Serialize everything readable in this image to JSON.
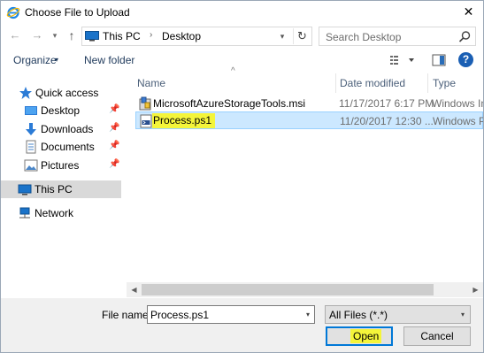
{
  "window": {
    "title": "Choose File to Upload",
    "close_glyph": "✕",
    "icon": "internet-explorer-icon"
  },
  "nav": {
    "back_glyph": "←",
    "forward_glyph": "→",
    "recent_glyph": "▾",
    "up_glyph": "↑",
    "address": {
      "breadcrumbs": [
        "This PC",
        "Desktop"
      ],
      "separator": "›",
      "dropdown_glyph": "▾",
      "refresh_glyph": "↻"
    },
    "search": {
      "placeholder": "Search Desktop"
    }
  },
  "toolbar": {
    "organize_label": "Organize",
    "organize_caret": "▾",
    "new_folder_label": "New folder",
    "help_glyph": "?"
  },
  "sidebar": {
    "pin_glyph": "📌",
    "items": [
      {
        "label": "Quick access",
        "icon": "star-icon",
        "pinned": false
      },
      {
        "label": "Desktop",
        "icon": "desktop-folder-icon",
        "pinned": true
      },
      {
        "label": "Downloads",
        "icon": "download-arrow-icon",
        "pinned": true
      },
      {
        "label": "Documents",
        "icon": "documents-icon",
        "pinned": true
      },
      {
        "label": "Pictures",
        "icon": "pictures-icon",
        "pinned": true
      },
      {
        "label": "This PC",
        "icon": "computer-icon",
        "selected": true
      },
      {
        "label": "Network",
        "icon": "network-icon"
      }
    ]
  },
  "file_list": {
    "sort_caret": "^",
    "columns": [
      "Name",
      "Date modified",
      "Type"
    ],
    "rows": [
      {
        "name": "MicrosoftAzureStorageTools.msi",
        "date": "11/17/2017 6:17 PM",
        "type": "Windows Installer",
        "icon": "msi-installer-icon",
        "selected": false
      },
      {
        "name": "Process.ps1",
        "date": "11/20/2017 12:30 ...",
        "type": "Windows PowerShell",
        "icon": "powershell-script-icon",
        "selected": true
      }
    ]
  },
  "scrollbar": {
    "left_glyph": "◀",
    "right_glyph": "▶"
  },
  "footer": {
    "file_name_label": "File name:",
    "file_name_value": "Process.ps1",
    "file_type_value": "All Files (*.*)",
    "dropdown_glyph": "▾",
    "open_label": "Open",
    "cancel_label": "Cancel"
  },
  "colors": {
    "selection_bg": "#cce8ff",
    "highlight": "#f4f53a",
    "accent": "#0078d7"
  }
}
